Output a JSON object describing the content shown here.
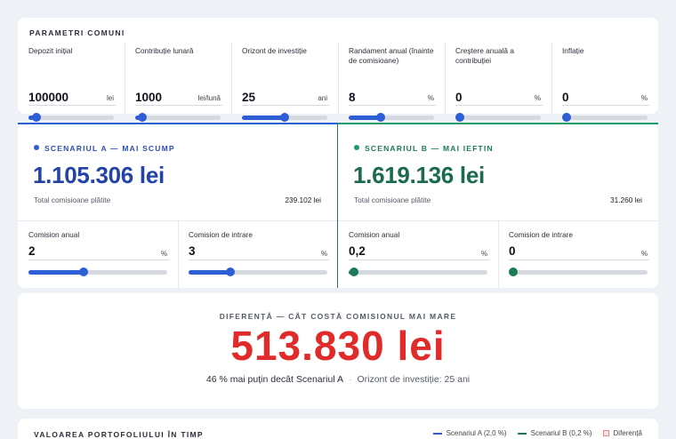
{
  "params": {
    "title": "PARAMETRI COMUNI",
    "items": [
      {
        "label": "Depozit inițial",
        "value": "100000",
        "unit": "lei",
        "fill_fraction": 0.09
      },
      {
        "label": "Contribuție lunară",
        "value": "1000",
        "unit": "lei/lună",
        "fill_fraction": 0.08
      },
      {
        "label": "Orizont de investiție",
        "value": "25",
        "unit": "ani",
        "fill_fraction": 0.5
      },
      {
        "label": "Randament anual (înainte de comisioane)",
        "value": "8",
        "unit": "%",
        "fill_fraction": 0.38
      },
      {
        "label": "Creștere anuală a contribuției",
        "value": "0",
        "unit": "%",
        "fill_fraction": 0.0
      },
      {
        "label": "Inflație",
        "value": "0",
        "unit": "%",
        "fill_fraction": 0.0
      }
    ]
  },
  "scenario_a": {
    "title": "SCENARIUL A — MAI SCUMP",
    "amount": "1.105.306 lei",
    "fees_label": "Total comisioane plătite",
    "fees_value": "239.102 lei",
    "annual_fee": {
      "label": "Comision anual",
      "value": "2",
      "unit": "%",
      "fill_fraction": 0.4
    },
    "entry_fee": {
      "label": "Comision de intrare",
      "value": "3",
      "unit": "%",
      "fill_fraction": 0.3
    }
  },
  "scenario_b": {
    "title": "SCENARIUL B — MAI IEFTIN",
    "amount": "1.619.136 lei",
    "fees_label": "Total comisioane plătite",
    "fees_value": "31.260 lei",
    "annual_fee": {
      "label": "Comision anual",
      "value": "0,2",
      "unit": "%",
      "fill_fraction": 0.04
    },
    "entry_fee": {
      "label": "Comision de intrare",
      "value": "0",
      "unit": "%",
      "fill_fraction": 0.0
    }
  },
  "difference": {
    "label": "DIFERENȚĂ — CÂT COSTĂ COMISIONUL MAI MARE",
    "amount": "513.830 lei",
    "note": "46 % mai puțin decât Scenariul A",
    "separator": "·",
    "horizon": "Orizont de investiție: 25 ani"
  },
  "chart_section": {
    "title": "VALOAREA PORTOFOLIULUI ÎN TIMP",
    "legend": [
      {
        "label": "Scenariul A (2,0 %)",
        "color": "#2e5ed6"
      },
      {
        "label": "Scenariul B (0,2 %)",
        "color": "#1c7b56"
      },
      {
        "label": "Diferență",
        "color": "#e12a2a"
      }
    ]
  },
  "colors": {
    "accent_a": "#2e5ed6",
    "accent_b": "#1c9c6a",
    "difference": "#e12a2a"
  }
}
